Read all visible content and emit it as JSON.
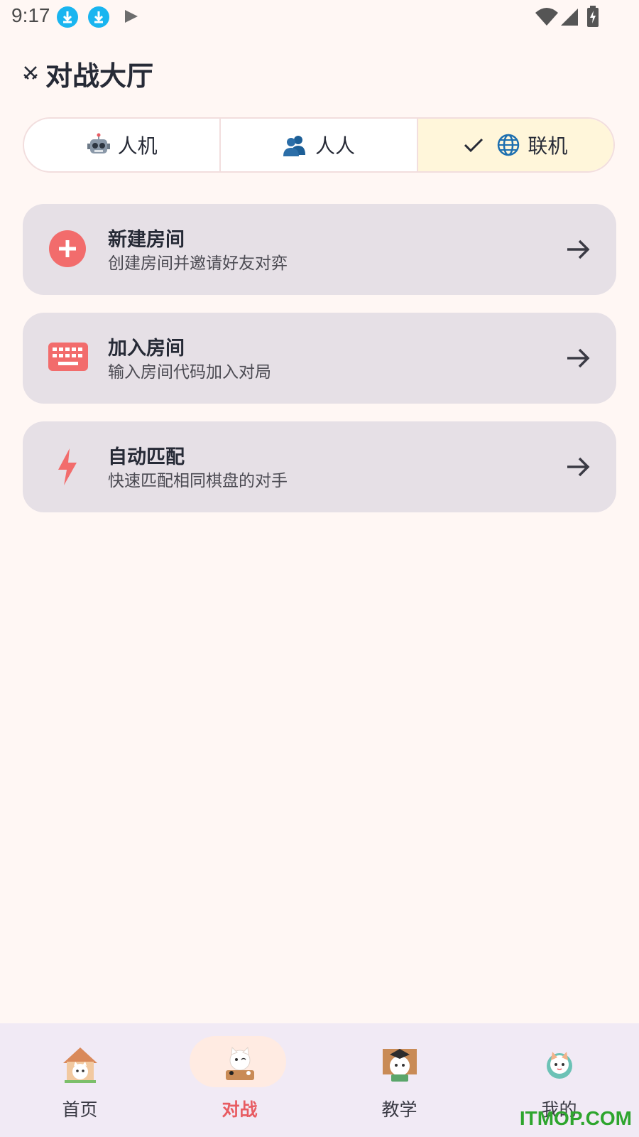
{
  "status_bar": {
    "time": "9:17",
    "icons": [
      "download-icon",
      "download-icon",
      "play-icon",
      "wifi-icon",
      "signal-icon",
      "battery-charging-icon"
    ]
  },
  "header": {
    "icon": "crossed-swords-icon",
    "title": "对战大厅"
  },
  "mode_tabs": [
    {
      "label": "人机",
      "icon": "robot-icon",
      "selected": false
    },
    {
      "label": "人人",
      "icon": "people-icon",
      "selected": false
    },
    {
      "label": "联机",
      "icon": "globe-icon",
      "selected": true
    }
  ],
  "actions": [
    {
      "title": "新建房间",
      "subtitle": "创建房间并邀请好友对弈",
      "icon": "add-circle-icon"
    },
    {
      "title": "加入房间",
      "subtitle": "输入房间代码加入对局",
      "icon": "keyboard-icon"
    },
    {
      "title": "自动匹配",
      "subtitle": "快速匹配相同棋盘的对手",
      "icon": "lightning-icon"
    }
  ],
  "bottom_nav": [
    {
      "label": "首页",
      "icon": "home-cat-icon",
      "active": false
    },
    {
      "label": "对战",
      "icon": "battle-cat-icon",
      "active": true
    },
    {
      "label": "教学",
      "icon": "teacher-cat-icon",
      "active": false
    },
    {
      "label": "我的",
      "icon": "profile-cat-icon",
      "active": false
    }
  ],
  "colors": {
    "background": "#fff7f4",
    "accent": "#ef6a6a",
    "selected_tab": "#fff6da",
    "card": "#e6e0e6"
  },
  "watermark": "ITMOP.COM"
}
